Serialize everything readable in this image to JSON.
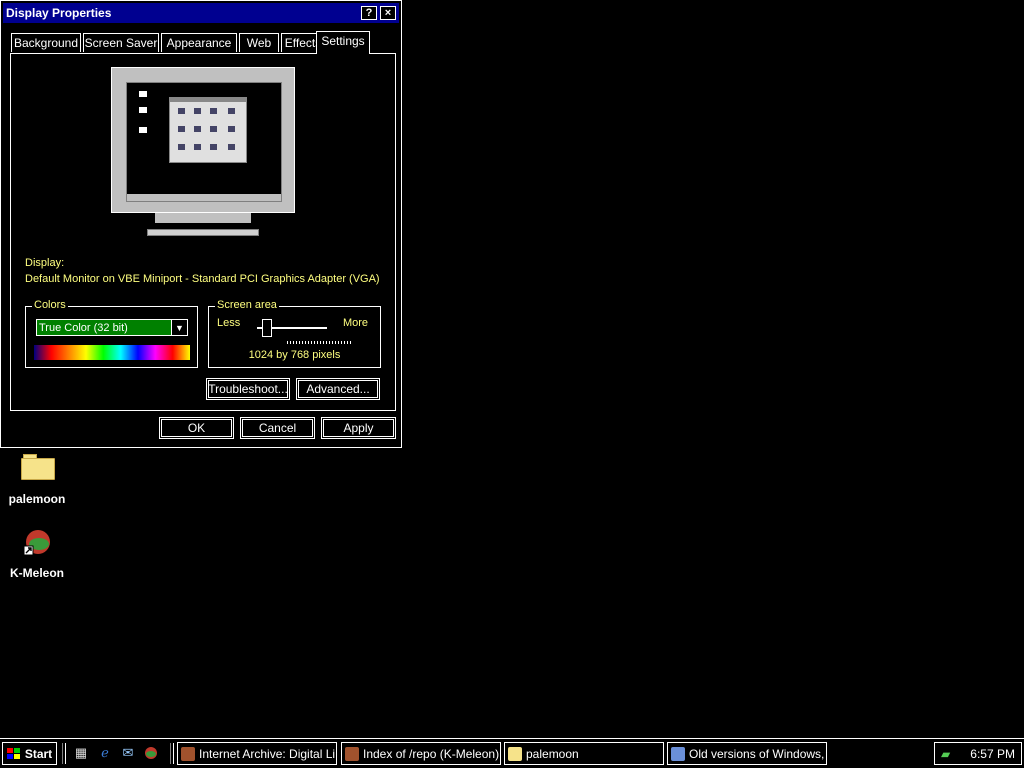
{
  "window": {
    "title": "Display Properties",
    "help_btn": "?",
    "close_btn": "×"
  },
  "tabs": [
    {
      "label": "Background"
    },
    {
      "label": "Screen Saver"
    },
    {
      "label": "Appearance"
    },
    {
      "label": "Web"
    },
    {
      "label": "Effects"
    },
    {
      "label": "Settings"
    }
  ],
  "active_tab": "Settings",
  "display": {
    "label": "Display:",
    "value": "Default Monitor on VBE Miniport - Standard PCI Graphics Adapter (VGA)"
  },
  "colors": {
    "group_title": "Colors",
    "selected": "True Color (32 bit)"
  },
  "screen_area": {
    "group_title": "Screen area",
    "less": "Less",
    "more": "More",
    "resolution": "1024 by 768 pixels"
  },
  "buttons": {
    "troubleshoot": "Troubleshoot...",
    "advanced": "Advanced...",
    "ok": "OK",
    "cancel": "Cancel",
    "apply": "Apply"
  },
  "desktop_icons": [
    {
      "label": "palemoon",
      "icon": "folder-icon"
    },
    {
      "label": "K-Meleon",
      "icon": "kmeleon-icon"
    }
  ],
  "taskbar": {
    "start": "Start",
    "tasks": [
      {
        "label": "Internet Archive: Digital Li..."
      },
      {
        "label": "Index of /repo (K-Meleon)"
      },
      {
        "label": "palemoon"
      },
      {
        "label": "Old versions of Windows, ..."
      }
    ],
    "clock": "6:57 PM"
  },
  "colors_theme": {
    "title_bar": "#000090",
    "label_text": "#ffff80",
    "select_bg": "#008000"
  }
}
